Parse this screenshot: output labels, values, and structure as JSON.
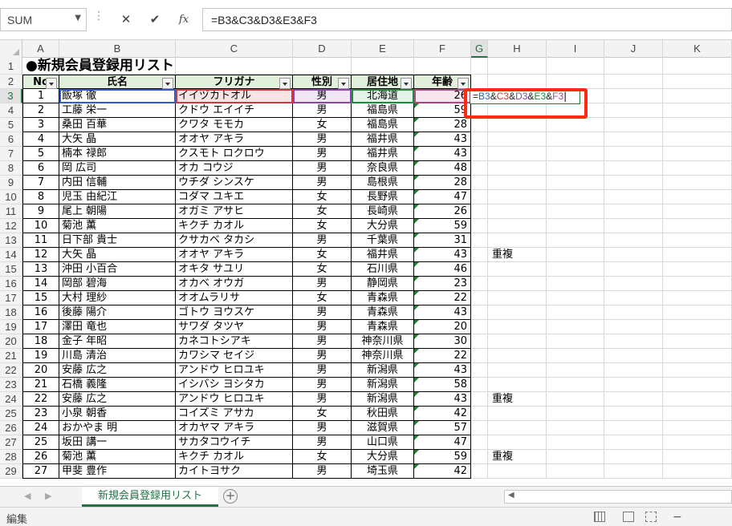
{
  "name_box": {
    "value": "SUM"
  },
  "formula_bar": {
    "cancel_symbol": "✕",
    "confirm_symbol": "✔",
    "fx_symbol": "fx",
    "formula": "=B3&C3&D3&E3&F3"
  },
  "columns": [
    "A",
    "B",
    "C",
    "D",
    "E",
    "F",
    "G",
    "H",
    "I",
    "J",
    "K"
  ],
  "selected_column": "G",
  "title": "●新規会員登録用リスト",
  "headers": [
    "No",
    "氏名",
    "フリガナ",
    "性別",
    "居住地",
    "年齢"
  ],
  "rows": [
    {
      "row": 3,
      "no": "1",
      "name": "飯塚 徹",
      "kana": "イイヅカトオル",
      "sex": "男",
      "place": "北海道",
      "age": "26",
      "h": ""
    },
    {
      "row": 4,
      "no": "2",
      "name": "工藤 栄一",
      "kana": "クドウ エイイチ",
      "sex": "男",
      "place": "福島県",
      "age": "59",
      "h": ""
    },
    {
      "row": 5,
      "no": "3",
      "name": "桑田 百華",
      "kana": "クワタ モモカ",
      "sex": "女",
      "place": "福島県",
      "age": "28",
      "h": ""
    },
    {
      "row": 6,
      "no": "4",
      "name": "大矢 晶",
      "kana": "オオヤ アキラ",
      "sex": "男",
      "place": "福井県",
      "age": "43",
      "h": ""
    },
    {
      "row": 7,
      "no": "5",
      "name": "楠本 禄郎",
      "kana": "クスモト ロクロウ",
      "sex": "男",
      "place": "福井県",
      "age": "43",
      "h": ""
    },
    {
      "row": 8,
      "no": "6",
      "name": "岡 広司",
      "kana": "オカ コウジ",
      "sex": "男",
      "place": "奈良県",
      "age": "48",
      "h": ""
    },
    {
      "row": 9,
      "no": "7",
      "name": "内田 信輔",
      "kana": "ウチダ シンスケ",
      "sex": "男",
      "place": "島根県",
      "age": "28",
      "h": ""
    },
    {
      "row": 10,
      "no": "8",
      "name": "児玉 由紀江",
      "kana": "コダマ ユキエ",
      "sex": "女",
      "place": "長野県",
      "age": "47",
      "h": ""
    },
    {
      "row": 11,
      "no": "9",
      "name": "尾上 朝陽",
      "kana": "オガミ アサヒ",
      "sex": "女",
      "place": "長崎県",
      "age": "26",
      "h": ""
    },
    {
      "row": 12,
      "no": "10",
      "name": "菊池 薫",
      "kana": "キクチ カオル",
      "sex": "女",
      "place": "大分県",
      "age": "59",
      "h": ""
    },
    {
      "row": 13,
      "no": "11",
      "name": "日下部 貴士",
      "kana": "クサカベ タカシ",
      "sex": "男",
      "place": "千葉県",
      "age": "31",
      "h": ""
    },
    {
      "row": 14,
      "no": "12",
      "name": "大矢 晶",
      "kana": "オオヤ アキラ",
      "sex": "女",
      "place": "福井県",
      "age": "43",
      "h": "重複"
    },
    {
      "row": 15,
      "no": "13",
      "name": "沖田 小百合",
      "kana": "オキタ サユリ",
      "sex": "女",
      "place": "石川県",
      "age": "46",
      "h": ""
    },
    {
      "row": 16,
      "no": "14",
      "name": "岡部 碧海",
      "kana": "オカベ オウガ",
      "sex": "男",
      "place": "静岡県",
      "age": "23",
      "h": ""
    },
    {
      "row": 17,
      "no": "15",
      "name": "大村 理紗",
      "kana": "オオムラリサ",
      "sex": "女",
      "place": "青森県",
      "age": "22",
      "h": ""
    },
    {
      "row": 18,
      "no": "16",
      "name": "後藤 陽介",
      "kana": "ゴトウ ヨウスケ",
      "sex": "男",
      "place": "青森県",
      "age": "43",
      "h": ""
    },
    {
      "row": 19,
      "no": "17",
      "name": "澤田 竜也",
      "kana": "サワダ タツヤ",
      "sex": "男",
      "place": "青森県",
      "age": "20",
      "h": ""
    },
    {
      "row": 20,
      "no": "18",
      "name": "金子 年昭",
      "kana": "カネコトシアキ",
      "sex": "男",
      "place": "神奈川県",
      "age": "30",
      "h": ""
    },
    {
      "row": 21,
      "no": "19",
      "name": "川島 清治",
      "kana": "カワシマ セイジ",
      "sex": "男",
      "place": "神奈川県",
      "age": "22",
      "h": ""
    },
    {
      "row": 22,
      "no": "20",
      "name": "安藤 広之",
      "kana": "アンドウ ヒロユキ",
      "sex": "男",
      "place": "新潟県",
      "age": "43",
      "h": ""
    },
    {
      "row": 23,
      "no": "21",
      "name": "石橋 義隆",
      "kana": "イシバシ ヨシタカ",
      "sex": "男",
      "place": "新潟県",
      "age": "58",
      "h": ""
    },
    {
      "row": 24,
      "no": "22",
      "name": "安藤 広之",
      "kana": "アンドウ ヒロユキ",
      "sex": "男",
      "place": "新潟県",
      "age": "43",
      "h": "重複"
    },
    {
      "row": 25,
      "no": "23",
      "name": "小泉 朝香",
      "kana": "コイズミ アサカ",
      "sex": "女",
      "place": "秋田県",
      "age": "42",
      "h": ""
    },
    {
      "row": 26,
      "no": "24",
      "name": "おかやま 明",
      "kana": "オカヤマ アキラ",
      "sex": "男",
      "place": "滋賀県",
      "age": "57",
      "h": ""
    },
    {
      "row": 27,
      "no": "25",
      "name": "坂田 講一",
      "kana": "サカタコウイチ",
      "sex": "男",
      "place": "山口県",
      "age": "47",
      "h": ""
    },
    {
      "row": 28,
      "no": "26",
      "name": "菊池 薫",
      "kana": "キクチ カオル",
      "sex": "女",
      "place": "大分県",
      "age": "59",
      "h": "重複"
    },
    {
      "row": 29,
      "no": "27",
      "name": "甲斐 豊作",
      "kana": "カイトヨサク",
      "sex": "男",
      "place": "埼玉県",
      "age": "42",
      "h": ""
    }
  ],
  "edit_cell": {
    "ref_parts": [
      {
        "text": "=",
        "color": "#222222"
      },
      {
        "text": "B3",
        "color": "#2f5ec4"
      },
      {
        "text": "&",
        "color": "#222222"
      },
      {
        "text": "C3",
        "color": "#d0393b"
      },
      {
        "text": "&",
        "color": "#222222"
      },
      {
        "text": "D3",
        "color": "#8e44ad"
      },
      {
        "text": "&",
        "color": "#222222"
      },
      {
        "text": "E3",
        "color": "#1e8a3a"
      },
      {
        "text": "&",
        "color": "#222222"
      },
      {
        "text": "F3",
        "color": "#b0457f"
      }
    ]
  },
  "sheet_tab": "新規会員登録用リスト",
  "status": "編集",
  "colors": {
    "header_fill": "#e2efda",
    "accent": "#217346",
    "highlight": "#ff2a10"
  }
}
